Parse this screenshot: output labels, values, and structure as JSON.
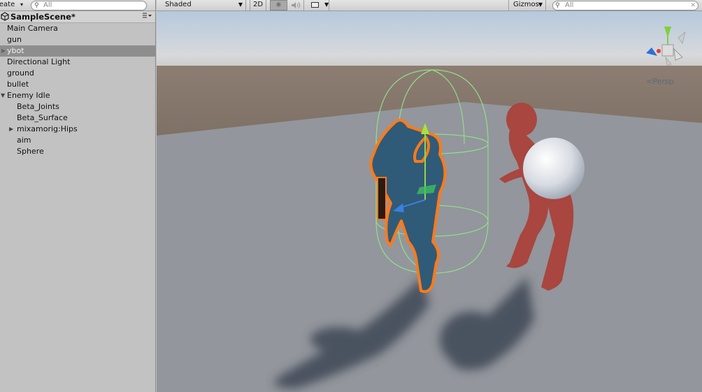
{
  "hierarchy": {
    "create_label": "reate",
    "create_arrow": "▾",
    "search_placeholder": "All",
    "search_icon": "search-icon",
    "scene_name": "SampleScene*",
    "scene_icon": "unity-logo-icon",
    "items": [
      {
        "label": "Main Camera"
      },
      {
        "label": "gun"
      },
      {
        "label": "ybot"
      },
      {
        "label": "Directional Light"
      },
      {
        "label": "ground"
      },
      {
        "label": "bullet"
      },
      {
        "label": "Enemy Idle"
      },
      {
        "label": "Beta_Joints"
      },
      {
        "label": "Beta_Surface"
      },
      {
        "label": "mixamorig:Hips"
      },
      {
        "label": "aim"
      },
      {
        "label": "Sphere"
      }
    ]
  },
  "scene_toolbar": {
    "draw_mode": "Shaded",
    "mode_2d": "2D",
    "lighting_icon": "sun-icon",
    "audio_icon": "speaker-icon",
    "effects_icon": "image-icon",
    "gizmos_label": "Gizmos",
    "search_placeholder": "All"
  },
  "viewport": {
    "projection_label": "Persp",
    "selection_color": "#ff7a1a",
    "collider_color": "#8fe08a"
  }
}
